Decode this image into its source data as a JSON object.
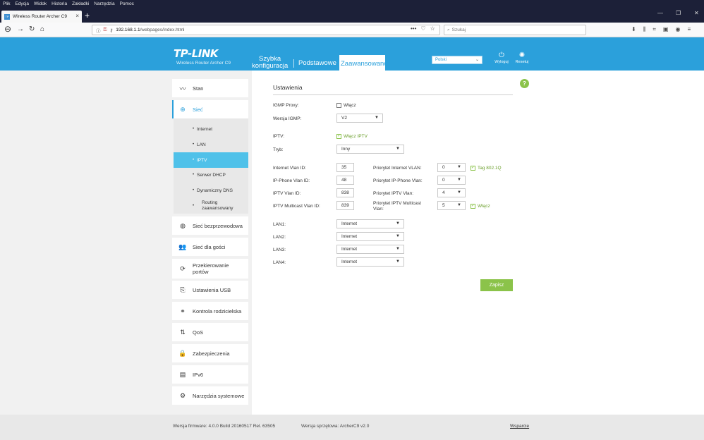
{
  "browser": {
    "menu": [
      "Plik",
      "Edycja",
      "Widok",
      "Historia",
      "Zakładki",
      "Narzędzia",
      "Pomoc"
    ],
    "tab_title": "Wireless Router Archer C9",
    "tab_icon_text": "TP",
    "url_host": "192.168.1.1",
    "url_path": "/webpages/index.html",
    "search_placeholder": "Szukaj"
  },
  "header": {
    "logo": "TP-LINK",
    "model": "Wireless Router Archer C9",
    "nav": [
      {
        "label_line1": "Szybka",
        "label_line2": "konfiguracja"
      },
      {
        "label": "Podstawowe"
      },
      {
        "label": "Zaawansowane"
      }
    ],
    "language": "Polski",
    "logout": "Wyloguj",
    "reset": "Resetuj"
  },
  "sidebar": {
    "stan": "Stan",
    "siec": "Sieć",
    "sub": [
      "Internet",
      "LAN",
      "IPTV",
      "Serwer DHCP",
      "Dynamiczny DNS"
    ],
    "routing_line1": "Routing",
    "routing_line2": "zaawansowany",
    "items": [
      "Sieć bezprzewodowa",
      "Sieć dla gości",
      "Przekierowanie",
      "Ustawienia USB",
      "Kontrola rodzicielska",
      "QoS",
      "Zabezpieczenia",
      "IPv6",
      "Narzędzia systemowe"
    ],
    "przek_line2": "portów"
  },
  "main": {
    "section_title": "Ustawienia",
    "igmp_proxy_label": "IGMP Proxy:",
    "igmp_proxy_check": "Włącz",
    "igmp_version_label": "Wersja IGMP:",
    "igmp_version": "V2",
    "iptv_label": "IPTV:",
    "iptv_check": "Włącz IPTV",
    "mode_label": "Tryb:",
    "mode": "Inny",
    "internet_vlan_label": "Internet Vlan ID:",
    "internet_vlan": "35",
    "phone_vlan_label": "IP-Phone Vlan ID:",
    "phone_vlan": "48",
    "iptv_vlan_label": "IPTV Vlan ID:",
    "iptv_vlan": "838",
    "multicast_vlan_label": "IPTV Multicast Vlan ID:",
    "multicast_vlan": "839",
    "prio_internet_label": "Priorytet Internet VLAN:",
    "prio_internet": "0",
    "tag_label": "Tag 802.1Q",
    "prio_phone_label": "Priorytet IP-Phone Vlan:",
    "prio_phone": "0",
    "prio_iptv_label": "Priorytet IPTV Vlan:",
    "prio_iptv": "4",
    "prio_multicast_line1": "Priorytet IPTV Multicast",
    "prio_multicast_line2": "Vlan:",
    "prio_multicast": "5",
    "multicast_enable": "Włącz",
    "lan1_label": "LAN1:",
    "lan1": "Internet",
    "lan2_label": "LAN2:",
    "lan2": "Internet",
    "lan3_label": "LAN3:",
    "lan3": "Internet",
    "lan4_label": "LAN4:",
    "lan4": "Internet",
    "save": "Zapisz",
    "help": "?"
  },
  "footer": {
    "firmware": "Wersja firmware: 4.0.0 Build 20160517 Rel. 63505",
    "hardware": "Wersja sprzętowa: ArcherC9 v2.0",
    "support": "Wsparcie"
  },
  "colors": {
    "accent": "#2ba0db",
    "green": "#8bc34a",
    "active_sub": "#4fc1e9"
  }
}
